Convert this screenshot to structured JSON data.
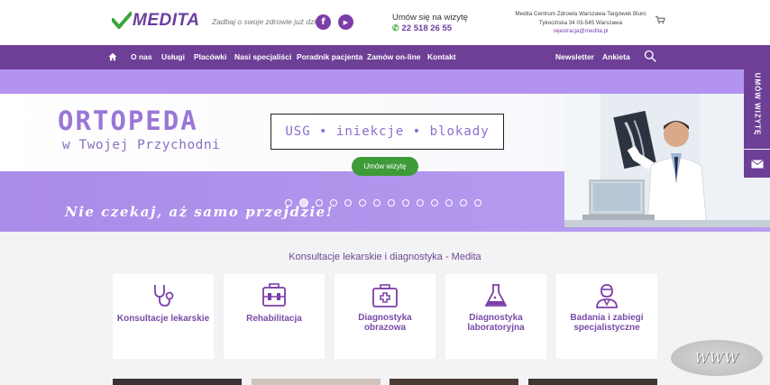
{
  "header": {
    "logo_text": "MEDITA",
    "tagline": "Zadbaj o swoje zdrowie już dziś!",
    "social": {
      "facebook": "f",
      "youtube": "▶"
    },
    "appointment_label": "Umów się na wizytę",
    "phone": "22 518 26 55",
    "address_line1": "Medita Centrum Zdrowia Warszawa-Targówek Biuro",
    "address_line2": "Tykocińska 34 03-545 Warszawa",
    "email": "rejestracja@medita.pl"
  },
  "nav": {
    "items": [
      "O nas",
      "Usługi",
      "Placówki",
      "Nasi specjaliści",
      "Poradnik pacjenta",
      "Zamów on-line",
      "Kontakt"
    ],
    "right_items": [
      "Newsletter",
      "Ankieta"
    ]
  },
  "hero": {
    "title": "ORTOPEDA",
    "subtitle": "w Twojej Przychodni",
    "box_text": "USG • iniekcje • blokady",
    "button": "Umów wizytę",
    "slogan": "Nie czekaj, aż samo przejdzie!",
    "slide_count": 14,
    "active_slide": 2
  },
  "side_tab": {
    "label": "UMÓW WIZYTĘ"
  },
  "section": {
    "title": "Konsultacje lekarskie i diagnostyka - Medita",
    "cards": [
      {
        "label": "Konsultacje lekarskie",
        "icon": "stethoscope-icon"
      },
      {
        "label": "Rehabilitacja",
        "icon": "rehabilitation-icon"
      },
      {
        "label": "Diagnostyka obrazowa",
        "icon": "medical-case-icon"
      },
      {
        "label": "Diagnostyka laboratoryjna",
        "icon": "flask-icon"
      },
      {
        "label": "Badania i zabiegi specjalistyczne",
        "icon": "doctor-icon"
      }
    ]
  },
  "watermark": "WWW",
  "colors": {
    "primary": "#6d3f97",
    "accent": "#b294f0",
    "button": "#3f9a3a"
  }
}
